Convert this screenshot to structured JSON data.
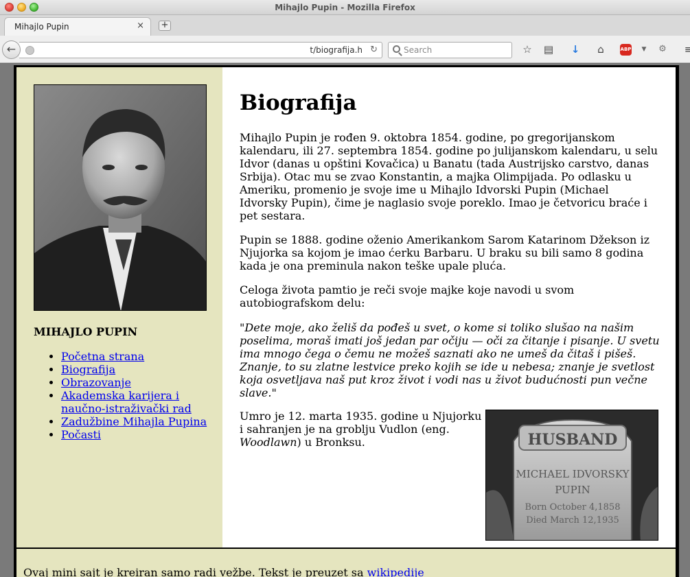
{
  "window": {
    "title": "Mihajlo Pupin - Mozilla Firefox"
  },
  "tab": {
    "title": "Mihajlo Pupin",
    "close_glyph": "×",
    "new_tab_glyph": "+"
  },
  "navbar": {
    "url": "t/biografija.h",
    "search_placeholder": "Search"
  },
  "icons": {
    "back": "arrow-left",
    "reload": "reload",
    "bookmark": "star",
    "bookmarks_list": "clipboard",
    "downloads": "down-arrow",
    "home": "house",
    "adblock": "ABP",
    "extension": "puzzle",
    "menu": "hamburger"
  },
  "sidebar": {
    "name": "MIHAJLO PUPIN",
    "nav": [
      {
        "label": "Početna strana"
      },
      {
        "label": "Biografija"
      },
      {
        "label": "Obrazovanje"
      },
      {
        "label": "Akademska karijera i naučno-istraživački rad"
      },
      {
        "label": "Zadužbine Mihajla Pupina"
      },
      {
        "label": "Počasti"
      }
    ]
  },
  "main": {
    "title": "Biografija",
    "p1": "Mihajlo Pupin je rođen 9. oktobra 1854. godine, po gregorijanskom kalendaru, ili 27. septembra 1854. godine po julijanskom kalendaru, u selu Idvor (danas u opštini Kovačica) u Banatu (tada Austrijsko carstvo, danas Srbija). Otac mu se zvao Konstantin, a majka Olimpijada. Po odlasku u Ameriku, promenio je svoje ime u Mihajlo Idvorski Pupin (Michael Idvorsky Pupin), čime je naglasio svoje poreklo. Imao je četvoricu braće i pet sestara.",
    "p2": "Pupin se 1888. godine oženio Amerikankom Sarom Katarinom Džekson iz Njujorka sa kojom je imao ćerku Barbaru. U braku su bili samo 8 godina kada je ona preminula nakon teške upale pluća.",
    "p3": "Celoga života pamtio je reči svoje majke koje navodi u svom autobiografskom delu:",
    "quote_open": "\"",
    "quote": "Dete moje, ako želiš da pođeš u svet, o kome si toliko slušao na našim poselima, moraš imati još jedan par očiju — oči za čitanje i pisanje. U svetu ima mnogo čega o čemu ne možeš saznati ako ne umeš da čitaš i pišeš. Znanje, to su zlatne lestvice preko kojih se ide u nebesa; znanje je svetlost koja osvetljava naš put kroz život i vodi nas u život budućnosti pun večne slave.",
    "quote_close": "\"",
    "p5_before": "Umro je 12. marta 1935. godine u Njujorku i sahranjen je na groblju Vudlon (eng. ",
    "p5_italic": "Woodlawn",
    "p5_after": ") u Bronksu.",
    "gravestone_lines": [
      "HUSBAND",
      "MICHAEL IDVORSKY",
      "PUPIN",
      "Born October 4,1858",
      "Died March 12,1935"
    ]
  },
  "footer": {
    "text": "Ovaj mini sajt je kreiran samo radi vežbe. Tekst je preuzet sa ",
    "link": "wikipedije"
  }
}
